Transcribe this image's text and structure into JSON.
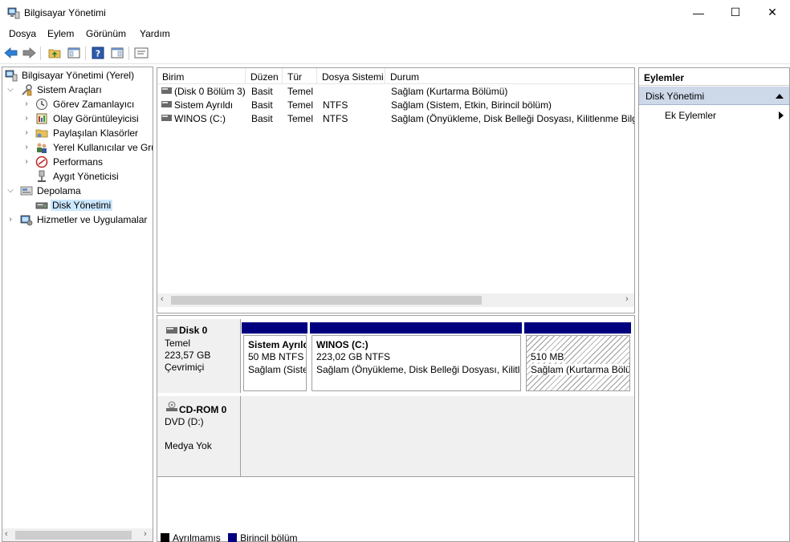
{
  "window": {
    "title": "Bilgisayar Yönetimi",
    "controls": {
      "minimize": "—",
      "maximize": "☐",
      "close": "✕"
    }
  },
  "menu": [
    "Dosya",
    "Eylem",
    "Görünüm",
    "Yardım"
  ],
  "tree": {
    "root": "Bilgisayar Yönetimi (Yerel)",
    "items": [
      "Sistem Araçları",
      "Görev Zamanlayıcı",
      "Olay Görüntüleyicisi",
      "Paylaşılan Klasörler",
      "Yerel Kullanıcılar ve Gru",
      "Performans",
      "Aygıt Yöneticisi",
      "Depolama",
      "Disk Yönetimi",
      "Hizmetler ve Uygulamalar"
    ]
  },
  "list": {
    "columns": [
      "Birim",
      "Düzen",
      "Tür",
      "Dosya Sistemi",
      "Durum"
    ],
    "rows": [
      [
        "(Disk 0 Bölüm 3)",
        "Basit",
        "Temel",
        "",
        "Sağlam (Kurtarma Bölümü)"
      ],
      [
        "Sistem Ayrıldı",
        "Basit",
        "Temel",
        "NTFS",
        "Sağlam (Sistem, Etkin, Birincil bölüm)"
      ],
      [
        "WINOS (C:)",
        "Basit",
        "Temel",
        "NTFS",
        "Sağlam (Önyükleme, Disk Belleği Dosyası, Kilitlenme Bilgis"
      ]
    ]
  },
  "disks": {
    "disk0": {
      "name": "Disk 0",
      "type": "Temel",
      "size": "223,57 GB",
      "status": "Çevrimiçi",
      "partitions": [
        {
          "name": "Sistem Ayrıld",
          "size": "50 MB NTFS",
          "status": "Sağlam (Siste"
        },
        {
          "name": "WINOS  (C:)",
          "size": "223,02 GB NTFS",
          "status": "Sağlam (Önyükleme, Disk Belleği Dosyası, Kilitle"
        },
        {
          "name": "",
          "size": "510 MB",
          "status": "Sağlam (Kurtarma Bölü"
        }
      ]
    },
    "cdrom0": {
      "name": "CD-ROM 0",
      "drive": "DVD (D:)",
      "status": "Medya Yok"
    }
  },
  "legend": [
    {
      "label": "Ayrılmamış",
      "color": "#000000"
    },
    {
      "label": "Birincil bölüm",
      "color": "#00007f"
    }
  ],
  "actions": {
    "title": "Eylemler",
    "section": "Disk Yönetimi",
    "more": "Ek Eylemler"
  },
  "colors": {
    "primary_partition": "#00007f",
    "selection": "#cce8ff",
    "actions_header": "#cdd8e8"
  }
}
